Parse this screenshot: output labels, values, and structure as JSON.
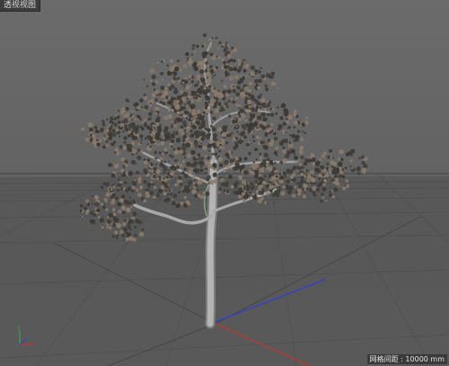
{
  "viewport": {
    "title": "透视视图",
    "grid_spacing_text": "网格间距 : 10000 mm"
  },
  "colors": {
    "axis_x": "#c0392b",
    "axis_y": "#3aa34a",
    "axis_z": "#2f3fd0",
    "foliage_dark": "#3d3a36",
    "foliage_light": "#8a7a6a",
    "trunk": "#a9a9a9",
    "grid_line": "#4e4e4e"
  },
  "icons": {
    "axis_gizmo": "axis-gizmo-icon"
  }
}
